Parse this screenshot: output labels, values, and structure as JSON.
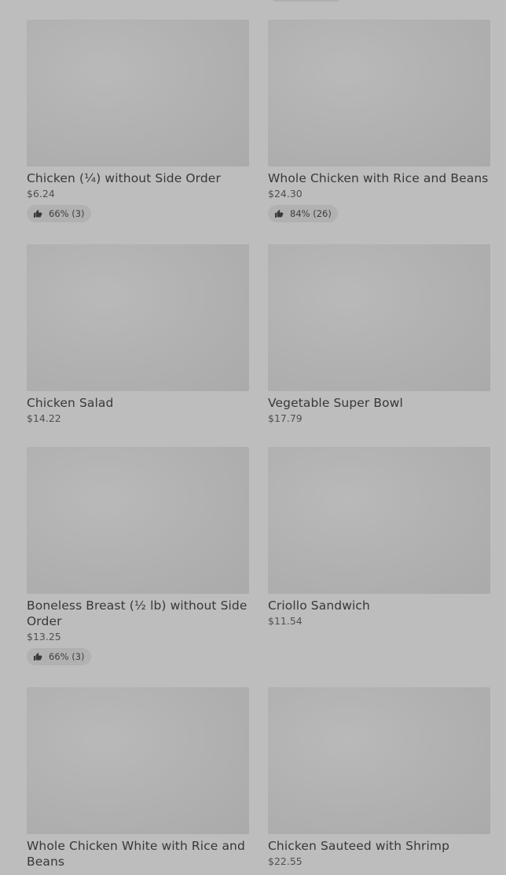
{
  "menu_items": [
    {
      "name": "Chicken (¼) without Side Order",
      "price": "$6.24",
      "rating": "66% (3)"
    },
    {
      "name": "Whole Chicken with Rice and Beans",
      "price": "$24.30",
      "rating": "84% (26)"
    },
    {
      "name": "Chicken Salad",
      "price": "$14.22",
      "rating": null
    },
    {
      "name": "Vegetable Super Bowl",
      "price": "$17.79",
      "rating": null
    },
    {
      "name": "Boneless Breast (½ lb) without Side Order",
      "price": "$13.25",
      "rating": "66% (3)"
    },
    {
      "name": "Criollo Sandwich",
      "price": "$11.54",
      "rating": null
    },
    {
      "name": "Whole Chicken White with Rice and Beans",
      "price": "",
      "rating": null
    },
    {
      "name": "Chicken Sauteed with Shrimp",
      "price": "$22.55",
      "rating": null
    }
  ],
  "colors": {
    "background": "#bdbdbd",
    "thumbnail": "#b2b2b2",
    "rating_pill": "#b1b1b1",
    "text": "#383838"
  },
  "icons": {
    "rating": "thumbs-up-icon"
  }
}
